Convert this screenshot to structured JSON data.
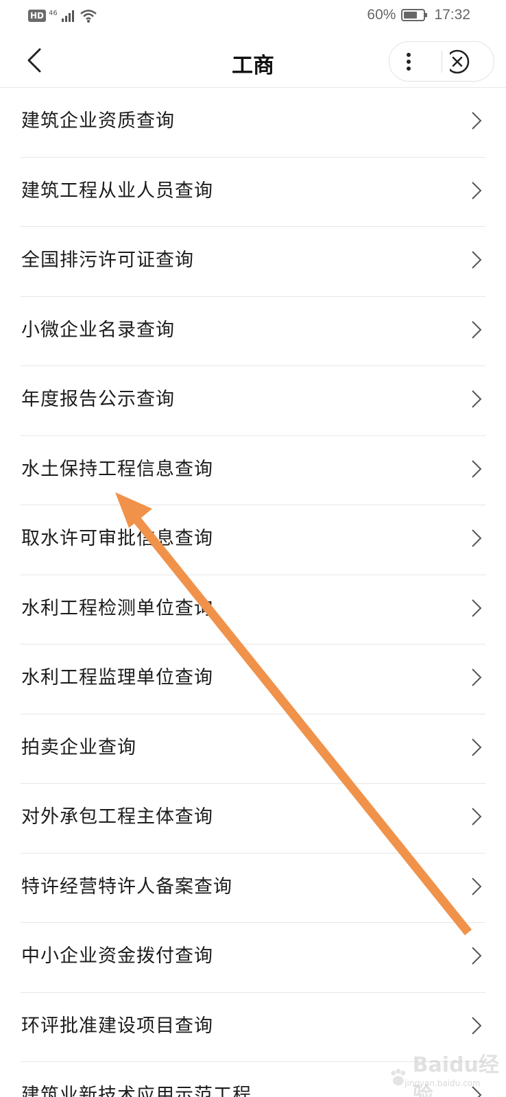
{
  "status_bar": {
    "hd": "HD",
    "network": "46",
    "battery_percent": "60%",
    "time": "17:32"
  },
  "header": {
    "title": "工商",
    "back_icon": "chevron-left-icon",
    "more_icon": "more-vertical-icon",
    "close_icon": "close-circle-icon"
  },
  "list": {
    "items": [
      {
        "label": "建筑企业资质查询"
      },
      {
        "label": "建筑工程从业人员查询"
      },
      {
        "label": "全国排污许可证查询"
      },
      {
        "label": "小微企业名录查询"
      },
      {
        "label": "年度报告公示查询"
      },
      {
        "label": "水土保持工程信息查询"
      },
      {
        "label": "取水许可审批信息查询"
      },
      {
        "label": "水利工程检测单位查询"
      },
      {
        "label": "水利工程监理单位查询"
      },
      {
        "label": "拍卖企业查询"
      },
      {
        "label": "对外承包工程主体查询"
      },
      {
        "label": "特许经营特许人备案查询"
      },
      {
        "label": "中小企业资金拨付查询"
      },
      {
        "label": "环评批准建设项目查询"
      },
      {
        "label": "建筑业新技术应用示范工程"
      }
    ]
  },
  "annotation": {
    "arrow_color": "#F0924A"
  },
  "watermark": {
    "text": "Baidu经验",
    "sub": "jingyan.baidu.com"
  }
}
